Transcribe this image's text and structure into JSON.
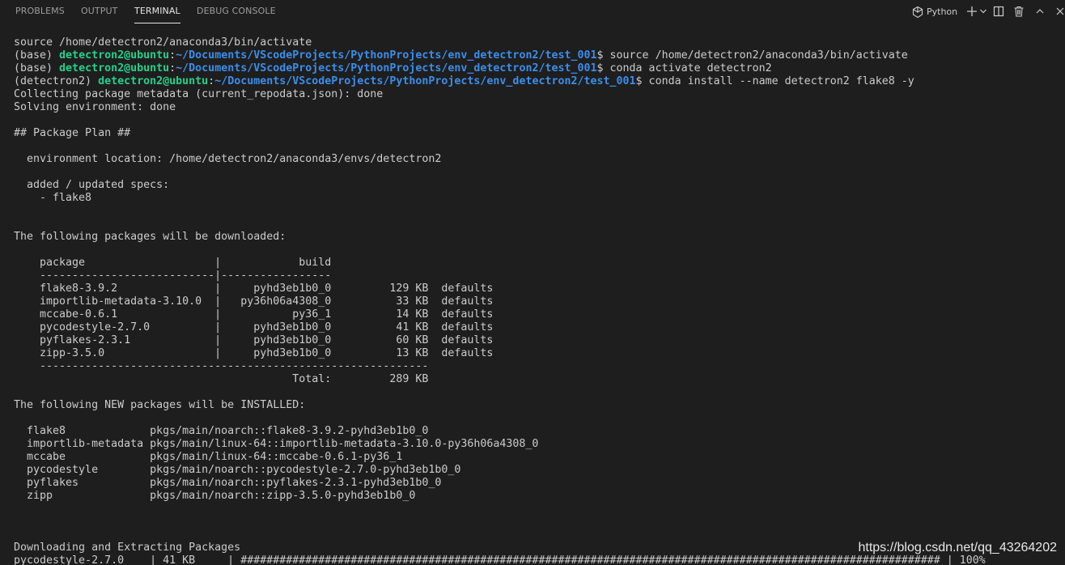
{
  "tabs": [
    {
      "label": "PROBLEMS"
    },
    {
      "label": "OUTPUT"
    },
    {
      "label": "TERMINAL"
    },
    {
      "label": "DEBUG CONSOLE"
    }
  ],
  "active_tab": "TERMINAL",
  "toolbar": {
    "shell_label": "Python",
    "icons": [
      "python-shell-icon",
      "plus-icon",
      "chevron-down-icon",
      "split-terminal-icon",
      "trash-icon",
      "chevron-up-icon",
      "close-icon"
    ]
  },
  "terminal": {
    "lines": [
      "source /home/detectron2/anaconda3/bin/activate",
      {
        "env": "(base) ",
        "user": "detectron2@ubuntu",
        "sep": ":",
        "path": "~/Documents/VScodeProjects/PythonProjects/env_detectron2/test_001",
        "cmd": "$ source /home/detectron2/anaconda3/bin/activate"
      },
      {
        "env": "(base) ",
        "user": "detectron2@ubuntu",
        "sep": ":",
        "path": "~/Documents/VScodeProjects/PythonProjects/env_detectron2/test_001",
        "cmd": "$ conda activate detectron2"
      },
      {
        "env": "(detectron2) ",
        "user": "detectron2@ubuntu",
        "sep": ":",
        "path": "~/Documents/VScodeProjects/PythonProjects/env_detectron2/test_001",
        "cmd": "$ conda install --name detectron2 flake8 -y"
      },
      "Collecting package metadata (current_repodata.json): done",
      "Solving environment: done",
      "",
      "## Package Plan ##",
      "",
      "  environment location: /home/detectron2/anaconda3/envs/detectron2",
      "",
      "  added / updated specs:",
      "    - flake8",
      "",
      "",
      "The following packages will be downloaded:",
      "",
      "    package                    |            build",
      "    ---------------------------|-----------------",
      "    flake8-3.9.2               |     pyhd3eb1b0_0         129 KB  defaults",
      "    importlib-metadata-3.10.0  |   py36h06a4308_0          33 KB  defaults",
      "    mccabe-0.6.1               |           py36_1          14 KB  defaults",
      "    pycodestyle-2.7.0          |     pyhd3eb1b0_0          41 KB  defaults",
      "    pyflakes-2.3.1             |     pyhd3eb1b0_0          60 KB  defaults",
      "    zipp-3.5.0                 |     pyhd3eb1b0_0          13 KB  defaults",
      "    ------------------------------------------------------------",
      "                                           Total:         289 KB",
      "",
      "The following NEW packages will be INSTALLED:",
      "",
      "  flake8             pkgs/main/noarch::flake8-3.9.2-pyhd3eb1b0_0",
      "  importlib-metadata pkgs/main/linux-64::importlib-metadata-3.10.0-py36h06a4308_0",
      "  mccabe             pkgs/main/linux-64::mccabe-0.6.1-py36_1",
      "  pycodestyle        pkgs/main/noarch::pycodestyle-2.7.0-pyhd3eb1b0_0",
      "  pyflakes           pkgs/main/noarch::pyflakes-2.3.1-pyhd3eb1b0_0",
      "  zipp               pkgs/main/noarch::zipp-3.5.0-pyhd3eb1b0_0",
      "",
      "",
      "",
      "Downloading and Extracting Packages",
      "pycodestyle-2.7.0    | 41 KB     | ############################################################################################################ | 100%"
    ]
  },
  "watermark": "https://blog.csdn.net/qq_43264202",
  "colors": {
    "background": "#1e1e1e",
    "text": "#cccccc",
    "user": "#23d18b",
    "path": "#3b8eea"
  }
}
